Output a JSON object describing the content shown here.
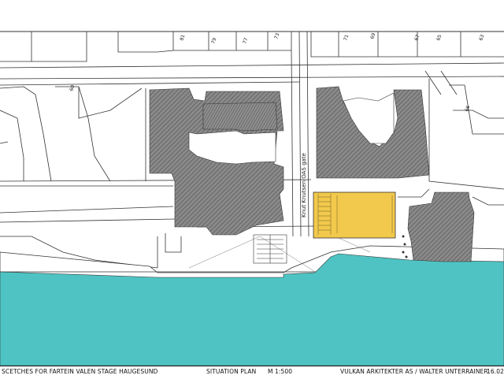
{
  "title_block": {
    "project": "SCETCHES FOR FARTEIN VALEN STAGE  HAUGESUND",
    "sheet": "SITUATION  PLAN",
    "scale": "M 1:500",
    "architects": "VULKAN ARKITEKTER AS / WALTER UNTERRAINER",
    "date": "16.02"
  },
  "street": {
    "name": "Knut Knutsen OAS gate"
  },
  "lot_numbers": [
    "81",
    "79",
    "77",
    "73",
    "71",
    "69",
    "67",
    "65",
    "63",
    "60",
    "66"
  ],
  "colors": {
    "water": "#4fc3c3",
    "new_building": "#f2c94c",
    "existing_buildings": "#7a7a7a",
    "lines": "#333333"
  }
}
